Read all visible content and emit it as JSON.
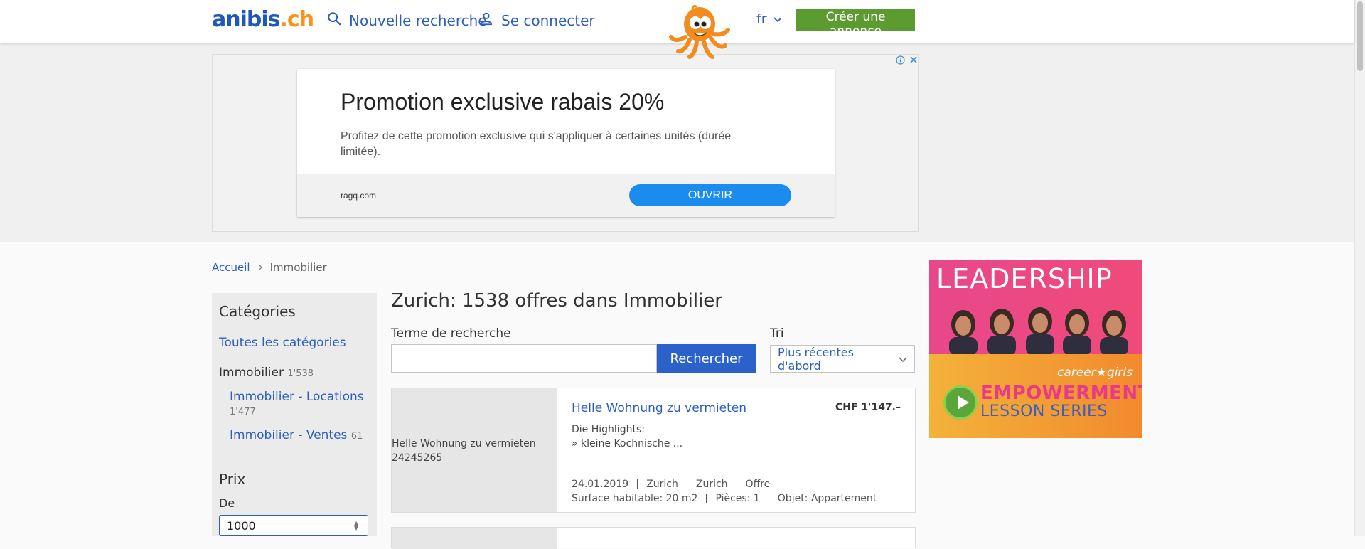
{
  "header": {
    "logo": {
      "main": "anibis",
      "dot": ".",
      "tld": "ch"
    },
    "new_search": "Nouvelle recherche",
    "login": "Se connecter",
    "language": "fr",
    "create_ad": "Créer une annonce",
    "accent_color": "#2b5fbf",
    "cta_color": "#5c9b2f"
  },
  "top_ad": {
    "headline": "Promotion exclusive rabais 20%",
    "body": "Profitez de cette promotion exclusive qui s'appliquer à certaines unités (durée limitée).",
    "domain": "ragq.com",
    "button": "OUVRIR",
    "adchoices_icon": "info-icon",
    "close_icon": "close-icon"
  },
  "breadcrumb": {
    "home": "Accueil",
    "current": "Immobilier"
  },
  "sidebar": {
    "categories_title": "Catégories",
    "all_categories": "Toutes les catégories",
    "immobilier": {
      "label": "Immobilier",
      "count": "1'538"
    },
    "locations": {
      "label": "Immobilier - Locations",
      "count": "1'477"
    },
    "ventes": {
      "label": "Immobilier - Ventes",
      "count": "61"
    },
    "price_title": "Prix",
    "from_label": "De",
    "from_value": "1000"
  },
  "main": {
    "title": "Zurich: 1538 offres dans Immobilier",
    "search_label": "Terme de recherche",
    "search_value": "",
    "search_button": "Rechercher",
    "sort_label": "Tri",
    "sort_value": "Plus récentes d'abord"
  },
  "listings": [
    {
      "image_alt": "Helle Wohnung zu vermieten 24245265",
      "title": "Helle Wohnung zu vermieten",
      "price": "CHF 1'147.–",
      "desc_line1": "Die Highlights:",
      "desc_line2": "» kleine Kochnische ...",
      "date": "24.01.2019",
      "city": "Zurich",
      "region": "Zurich",
      "type": "Offre",
      "surface": "Surface habitable: 20 m2",
      "rooms": "Pièces: 1",
      "object": "Objet: Appartement"
    }
  ],
  "side_ad": {
    "headline": "LEADERSHIP",
    "brand": "career★girls",
    "line1": "EMPOWERMENT",
    "line2": "LESSON SERIES"
  }
}
